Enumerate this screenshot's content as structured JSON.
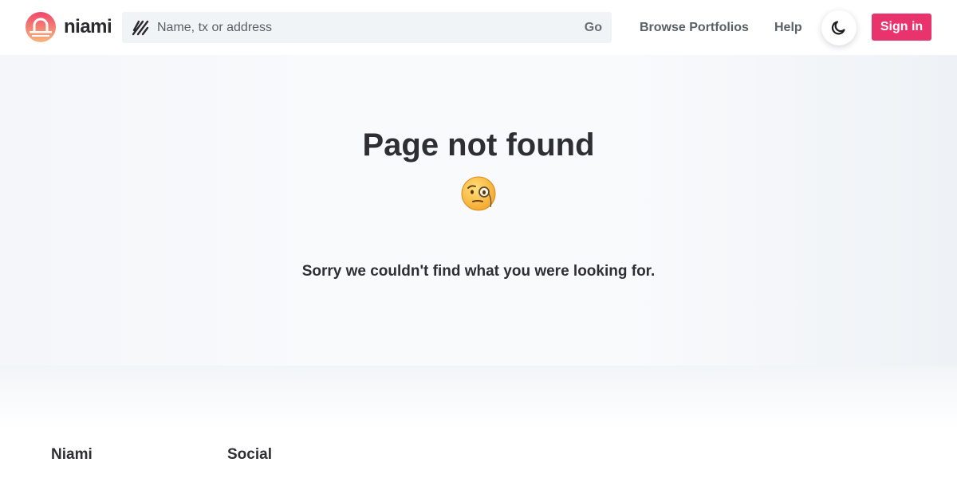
{
  "header": {
    "logo_text": "niami",
    "search": {
      "placeholder": "Name, tx or address",
      "go_label": "Go"
    },
    "nav": {
      "browse_label": "Browse Portfolios",
      "help_label": "Help"
    },
    "signin_label": "Sign in",
    "icons": {
      "logo": "niami-logo-icon",
      "search": "hns-logo-icon",
      "theme": "moon-icon"
    },
    "colors": {
      "brand": "#e8336d",
      "logo_top": "#f0466b",
      "logo_bottom": "#f7b77a"
    }
  },
  "main": {
    "title": "Page not found",
    "emoji": "face-with-monocle",
    "message": "Sorry we couldn't find what you were looking for."
  },
  "footer": {
    "headings": [
      "Niami",
      "Social"
    ]
  }
}
